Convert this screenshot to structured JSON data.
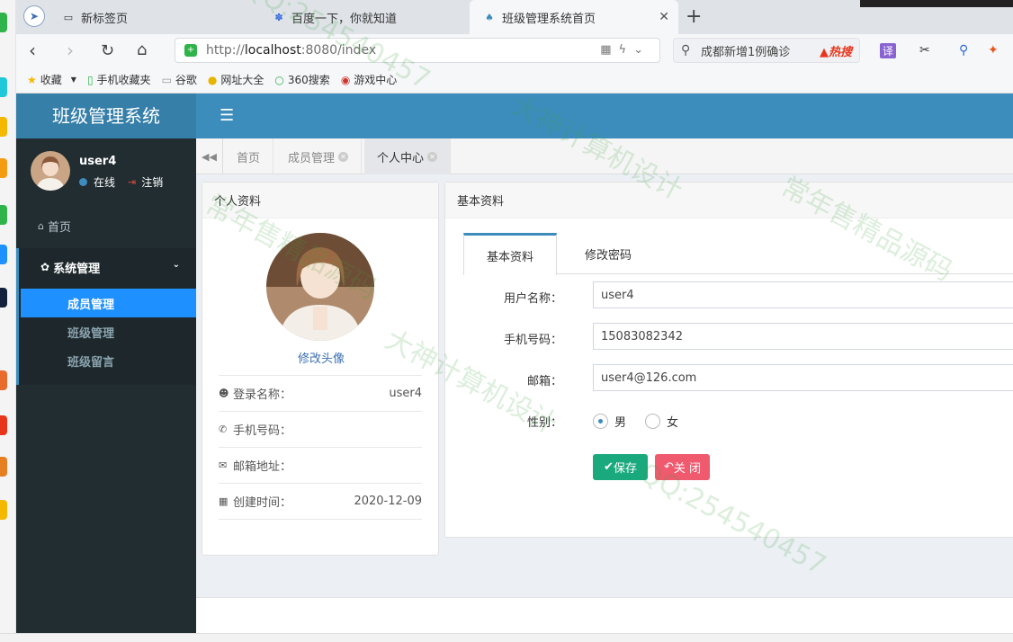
{
  "browser": {
    "tabs": [
      {
        "label": "新标签页"
      },
      {
        "label": "百度一下，你就知道"
      },
      {
        "label": "班级管理系统首页"
      }
    ],
    "url_prefix": "http://",
    "url_host": "localhost",
    "url_rest": ":8080/index",
    "search_text": "成都新增1例确诊",
    "search_hot": "热搜",
    "bookmarks": [
      "收藏",
      "手机收藏夹",
      "谷歌",
      "网址大全",
      "360搜索",
      "游戏中心"
    ],
    "extension_label": "译"
  },
  "app": {
    "title": "班级管理系统",
    "toggle_icon": "☰"
  },
  "sidebar": {
    "username": "user4",
    "status": "在线",
    "logout": "注销",
    "home": "首页",
    "group": "系统管理",
    "items": [
      "成员管理",
      "班级管理",
      "班级留言"
    ]
  },
  "content_tabs": [
    {
      "label": "首页"
    },
    {
      "label": "成员管理"
    },
    {
      "label": "个人中心"
    }
  ],
  "profile": {
    "header": "个人资料",
    "change_avatar": "修改头像",
    "rows": [
      {
        "label": "登录名称：",
        "value": "user4"
      },
      {
        "label": "手机号码：",
        "value": ""
      },
      {
        "label": "邮箱地址：",
        "value": ""
      },
      {
        "label": "创建时间：",
        "value": "2020-12-09"
      }
    ]
  },
  "basic": {
    "header": "基本资料",
    "tabs": [
      "基本资料",
      "修改密码"
    ],
    "fields": [
      {
        "label": "用户名称：",
        "value": "user4"
      },
      {
        "label": "手机号码：",
        "value": "15083082342"
      },
      {
        "label": "邮箱：",
        "value": "user4@126.com"
      }
    ],
    "gender_label": "性别：",
    "gender_options": [
      "男",
      "女"
    ],
    "save": "保存",
    "close": "关 闭"
  },
  "watermarks": [
    "QQ:254540457",
    "大神计算机设计",
    "常年售精品源码"
  ],
  "colors": {
    "header": "#3c8dbc",
    "sidebar": "#222d32",
    "active_item": "#1e90ff",
    "save": "#1aa97d",
    "close": "#ef5a6e"
  }
}
